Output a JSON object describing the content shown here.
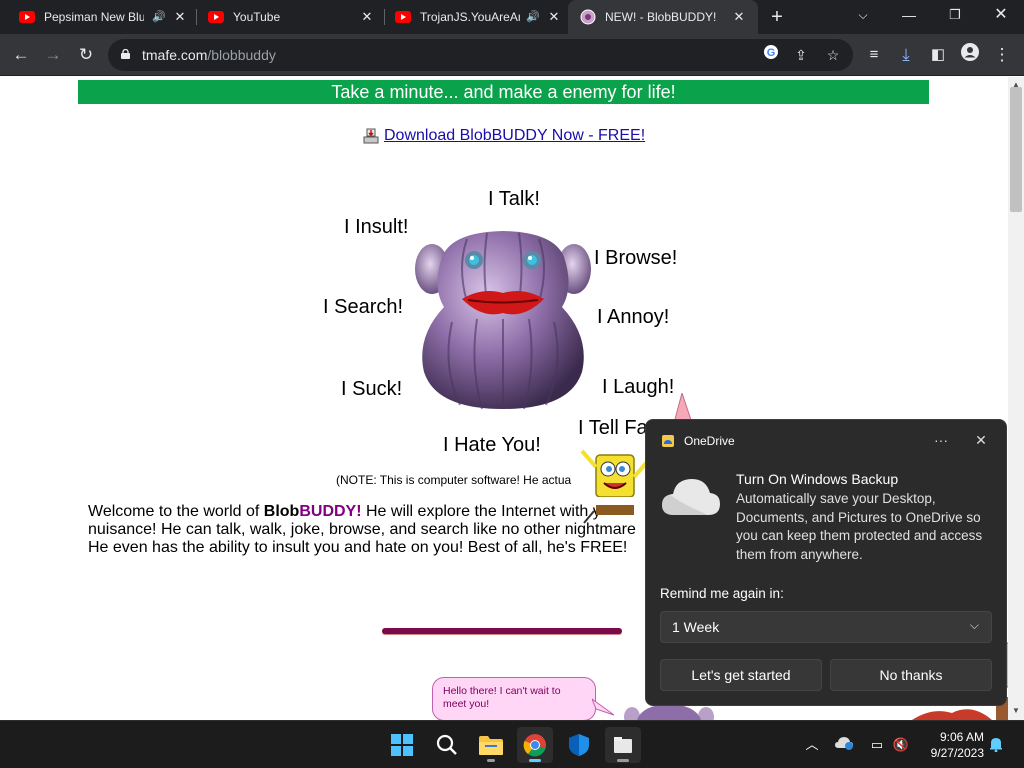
{
  "browser": {
    "tabs": [
      {
        "title": "Pepsiman New Blu",
        "favicon": "youtube-icon",
        "audio": true,
        "active": false
      },
      {
        "title": "YouTube",
        "favicon": "youtube-icon",
        "audio": false,
        "active": false
      },
      {
        "title": "TrojanJS.YouAreAn",
        "favicon": "youtube-icon",
        "audio": true,
        "active": false
      },
      {
        "title": "NEW! - BlobBUDDY!",
        "favicon": "blobbuddy-icon",
        "audio": false,
        "active": true
      }
    ],
    "new_tab_glyph": "+",
    "url_domain": "tmafe.com",
    "url_path": "/blobbuddy"
  },
  "page": {
    "banner": "Take a minute... and make a enemy for life!",
    "download_link": "Download BlobBUDDY Now - FREE!",
    "labels": {
      "talk": "I Talk!",
      "insult": "I Insult!",
      "browse": "I Browse!",
      "search": "I Search!",
      "annoy": "I Annoy!",
      "suck": "I Suck!",
      "laugh": "I Laugh!",
      "tell": "I Tell Fa",
      "hate": "I Hate You!"
    },
    "note": "(NOTE: This is computer software! He actua",
    "welcome": {
      "intro": "Welcome to the world of ",
      "brand_a": "Blob",
      "brand_b": "BUDDY",
      "exclaim": "!",
      "line1_rest": " He will explore the Internet with y",
      "line2": "nuisance!  He can talk, walk, joke, browse, and search like no other nightmare",
      "line3": "He even has the ability to insult you and hate on you! Best of all, he's FREE!"
    },
    "bubble": "Hello there!  I can't wait to meet you!"
  },
  "toast": {
    "app_name": "OneDrive",
    "title": "Turn On Windows Backup",
    "body": "Automatically save your Desktop, Documents, and Pictures to OneDrive so you can keep them protected and access them from anywhere.",
    "remind_label": "Remind me again in:",
    "remind_value": "1 Week",
    "primary_button": "Let's get started",
    "secondary_button": "No thanks",
    "more_glyph": "···",
    "close_glyph": "✕"
  },
  "taskbar": {
    "time": "9:06 AM",
    "date": "9/27/2023",
    "apps": [
      "windows-start-icon",
      "search-icon",
      "file-explorer-icon",
      "chrome-icon",
      "windows-security-icon",
      "app-icon"
    ]
  },
  "colors": {
    "banner_green": "#0aa24a",
    "brand_purple": "#800080",
    "toast_bg": "#2b2b2b",
    "taskbar_bg": "#1c1c1c"
  }
}
